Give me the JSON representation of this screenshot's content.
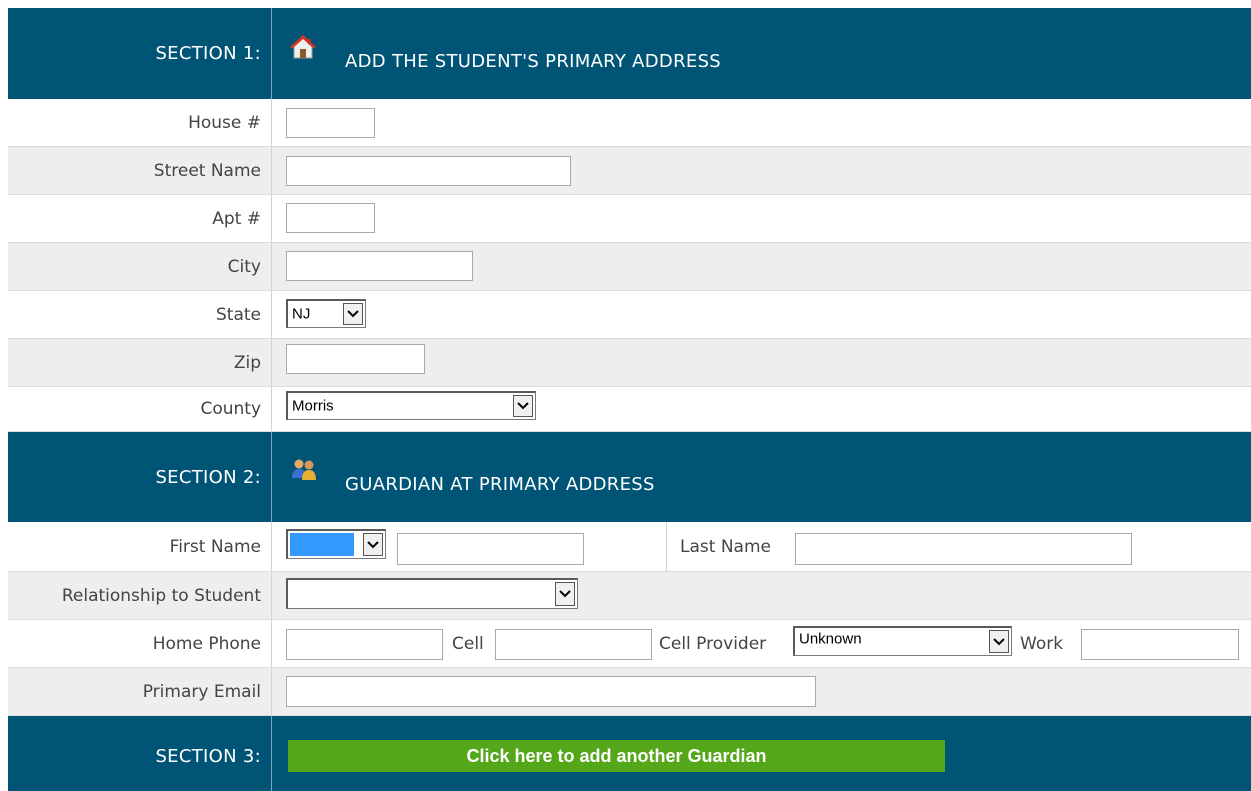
{
  "section1": {
    "label": "SECTION 1:",
    "title": "ADD THE STUDENT'S PRIMARY ADDRESS",
    "icon": "house-icon",
    "fields": {
      "house_label": "House #",
      "street_label": "Street Name",
      "apt_label": "Apt #",
      "city_label": "City",
      "state_label": "State",
      "state_value": "NJ",
      "zip_label": "Zip",
      "county_label": "County",
      "county_value": "Morris"
    }
  },
  "section2": {
    "label": "SECTION 2:",
    "title": "GUARDIAN AT PRIMARY ADDRESS",
    "icon": "people-icon",
    "fields": {
      "first_name_label": "First Name",
      "prefix_value": "",
      "last_name_label": "Last Name",
      "relationship_label": "Relationship to Student",
      "relationship_value": "",
      "home_phone_label": "Home Phone",
      "cell_label": "Cell",
      "cell_provider_label": "Cell Provider",
      "cell_provider_value": "Unknown",
      "work_label": "Work",
      "email_label": "Primary Email"
    }
  },
  "section3": {
    "label": "SECTION 3:",
    "button_label": "Click here to add another Guardian"
  },
  "colors": {
    "section_bg": "#005576",
    "row_alt": "#eeeeee",
    "button_green": "#55a71a",
    "prefix_highlight": "#3399ff"
  }
}
